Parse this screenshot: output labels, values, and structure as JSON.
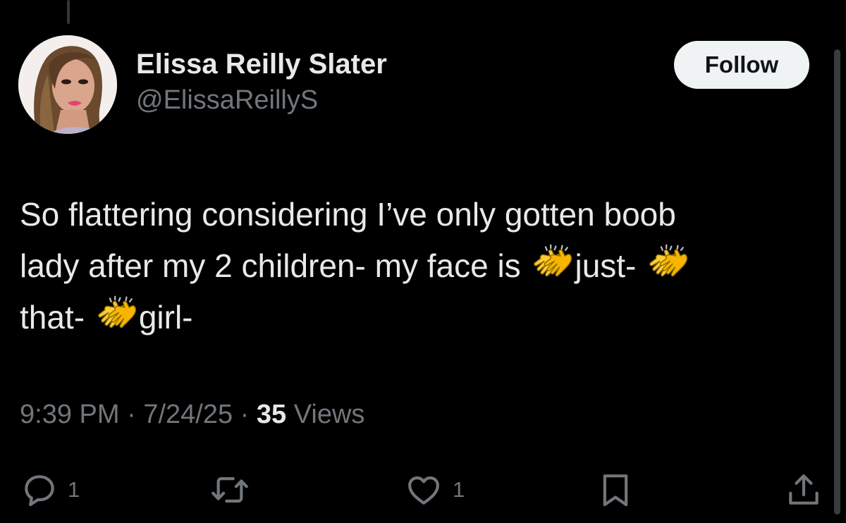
{
  "tweet": {
    "author": {
      "display_name": "Elissa Reilly Slater",
      "handle": "@ElissaReillyS"
    },
    "follow_label": "Follow",
    "text_lines": [
      [
        "So flattering considering I’ve only gotten boob"
      ],
      [
        "lady after my 2 children- my face is ",
        "just- "
      ],
      [
        "that- ",
        "girl-"
      ]
    ],
    "text": {
      "line1": "So flattering considering I’ve only gotten boob",
      "line2a": "lady after my 2 children- my face is ",
      "line2b": "just- ",
      "line3a": "that- ",
      "line3b": "girl-"
    },
    "emoji": "clapping-hands",
    "time": "9:39 PM",
    "separator": "·",
    "date": "7/24/25",
    "views_count": "35",
    "views_label": "Views",
    "replies_count": "1",
    "likes_count": "1"
  },
  "colors": {
    "background": "#000000",
    "primary_text": "#e7e9ea",
    "secondary_text": "#71767b",
    "follow_button_bg": "#eff3f4",
    "follow_button_text": "#0f1419"
  },
  "icons": {
    "reply": "speech-bubble-icon",
    "repost": "repost-arrows-icon",
    "like": "heart-icon",
    "bookmark": "bookmark-icon",
    "share": "share-upload-icon"
  }
}
